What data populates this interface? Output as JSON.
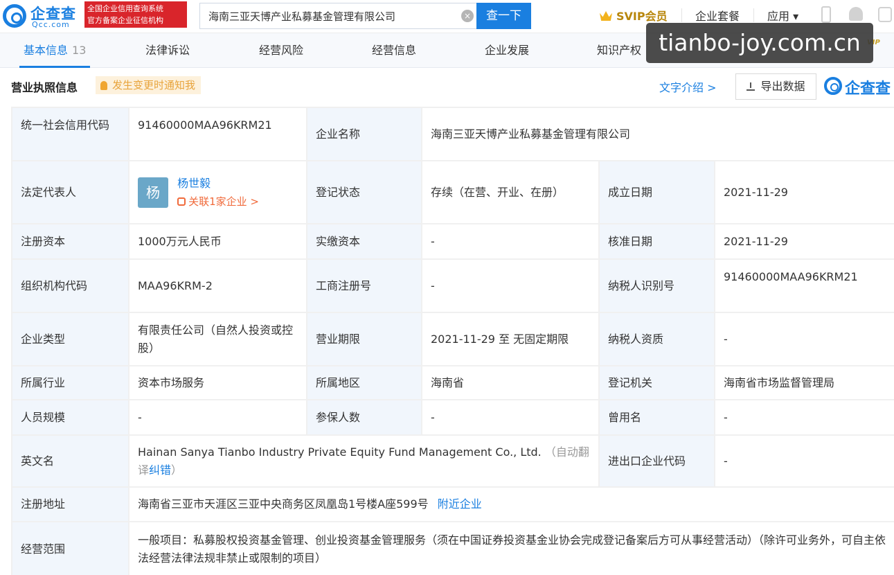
{
  "header": {
    "logo_name": "企查查",
    "logo_domain": "Qcc.com",
    "gov_badge_line1": "全国企业信用查询系统",
    "gov_badge_line2": "官方备案企业征信机构",
    "search_value": "海南三亚天博产业私募基金管理有限公司",
    "search_button": "查一下",
    "svip": "SVIP会员",
    "nav_package": "企业套餐",
    "nav_apps": "应用 ▾"
  },
  "tabs": [
    {
      "label": "基本信息",
      "count": "13"
    },
    {
      "label": "法律诉讼"
    },
    {
      "label": "经营风险"
    },
    {
      "label": "经营信息"
    },
    {
      "label": "企业发展"
    },
    {
      "label": "知识产权"
    }
  ],
  "tab_badge": "VIP",
  "watermark": "tianbo-joy.com.cn",
  "section": {
    "title": "营业执照信息",
    "notify": "发生变更时通知我",
    "text_intro": "文字介绍 >",
    "export": "导出数据",
    "qcc_mark": "企查查"
  },
  "colors": {
    "accent": "#1a7fe0",
    "label_bg": "#f1f6fc",
    "gov_red": "#d9252b",
    "related_orange": "#f06a3b"
  },
  "company": {
    "credit_code_label": "统一社会信用代码",
    "credit_code": "91460000MAA96KRM21",
    "name_label": "企业名称",
    "name": "海南三亚天博产业私募基金管理有限公司",
    "legal_rep_label": "法定代表人",
    "avatar_char": "杨",
    "legal_rep": "杨世毅",
    "related": "关联1家企业 >",
    "status_label": "登记状态",
    "status": "存续（在营、开业、在册）",
    "founded_label": "成立日期",
    "founded": "2021-11-29",
    "capital_label": "注册资本",
    "capital": "1000万元人民币",
    "paid_capital_label": "实缴资本",
    "paid_capital": "-",
    "approved_label": "核准日期",
    "approved": "2021-11-29",
    "org_code_label": "组织机构代码",
    "org_code": "MAA96KRM-2",
    "reg_no_label": "工商注册号",
    "reg_no": "-",
    "taxpayer_id_label": "纳税人识别号",
    "taxpayer_id": "91460000MAA96KRM21",
    "type_label": "企业类型",
    "type": "有限责任公司（自然人投资或控股）",
    "term_label": "营业期限",
    "term": "2021-11-29 至 无固定期限",
    "taxpayer_qual_label": "纳税人资质",
    "taxpayer_qual": "-",
    "industry_label": "所属行业",
    "industry": "资本市场服务",
    "region_label": "所属地区",
    "region": "海南省",
    "authority_label": "登记机关",
    "authority": "海南省市场监督管理局",
    "staff_label": "人员规模",
    "staff": "-",
    "insured_label": "参保人数",
    "insured": "-",
    "former_name_label": "曾用名",
    "former_name": "-",
    "english_label": "英文名",
    "english": "Hainan Sanya Tianbo Industry Private Equity Fund Management Co., Ltd.",
    "english_note_open": "（自动翻译",
    "english_fix": "纠错",
    "english_note_close": "）",
    "import_export_label": "进出口企业代码",
    "import_export": "-",
    "address_label": "注册地址",
    "address": "海南省三亚市天涯区三亚中央商务区凤凰岛1号楼A座599号",
    "nearby": "附近企业",
    "scope_label": "经营范围",
    "scope": "一般项目：私募股权投资基金管理、创业投资基金管理服务（须在中国证券投资基金业协会完成登记备案后方可从事经营活动）（除许可业务外，可自主依法经营法律法规非禁止或限制的项目）"
  }
}
